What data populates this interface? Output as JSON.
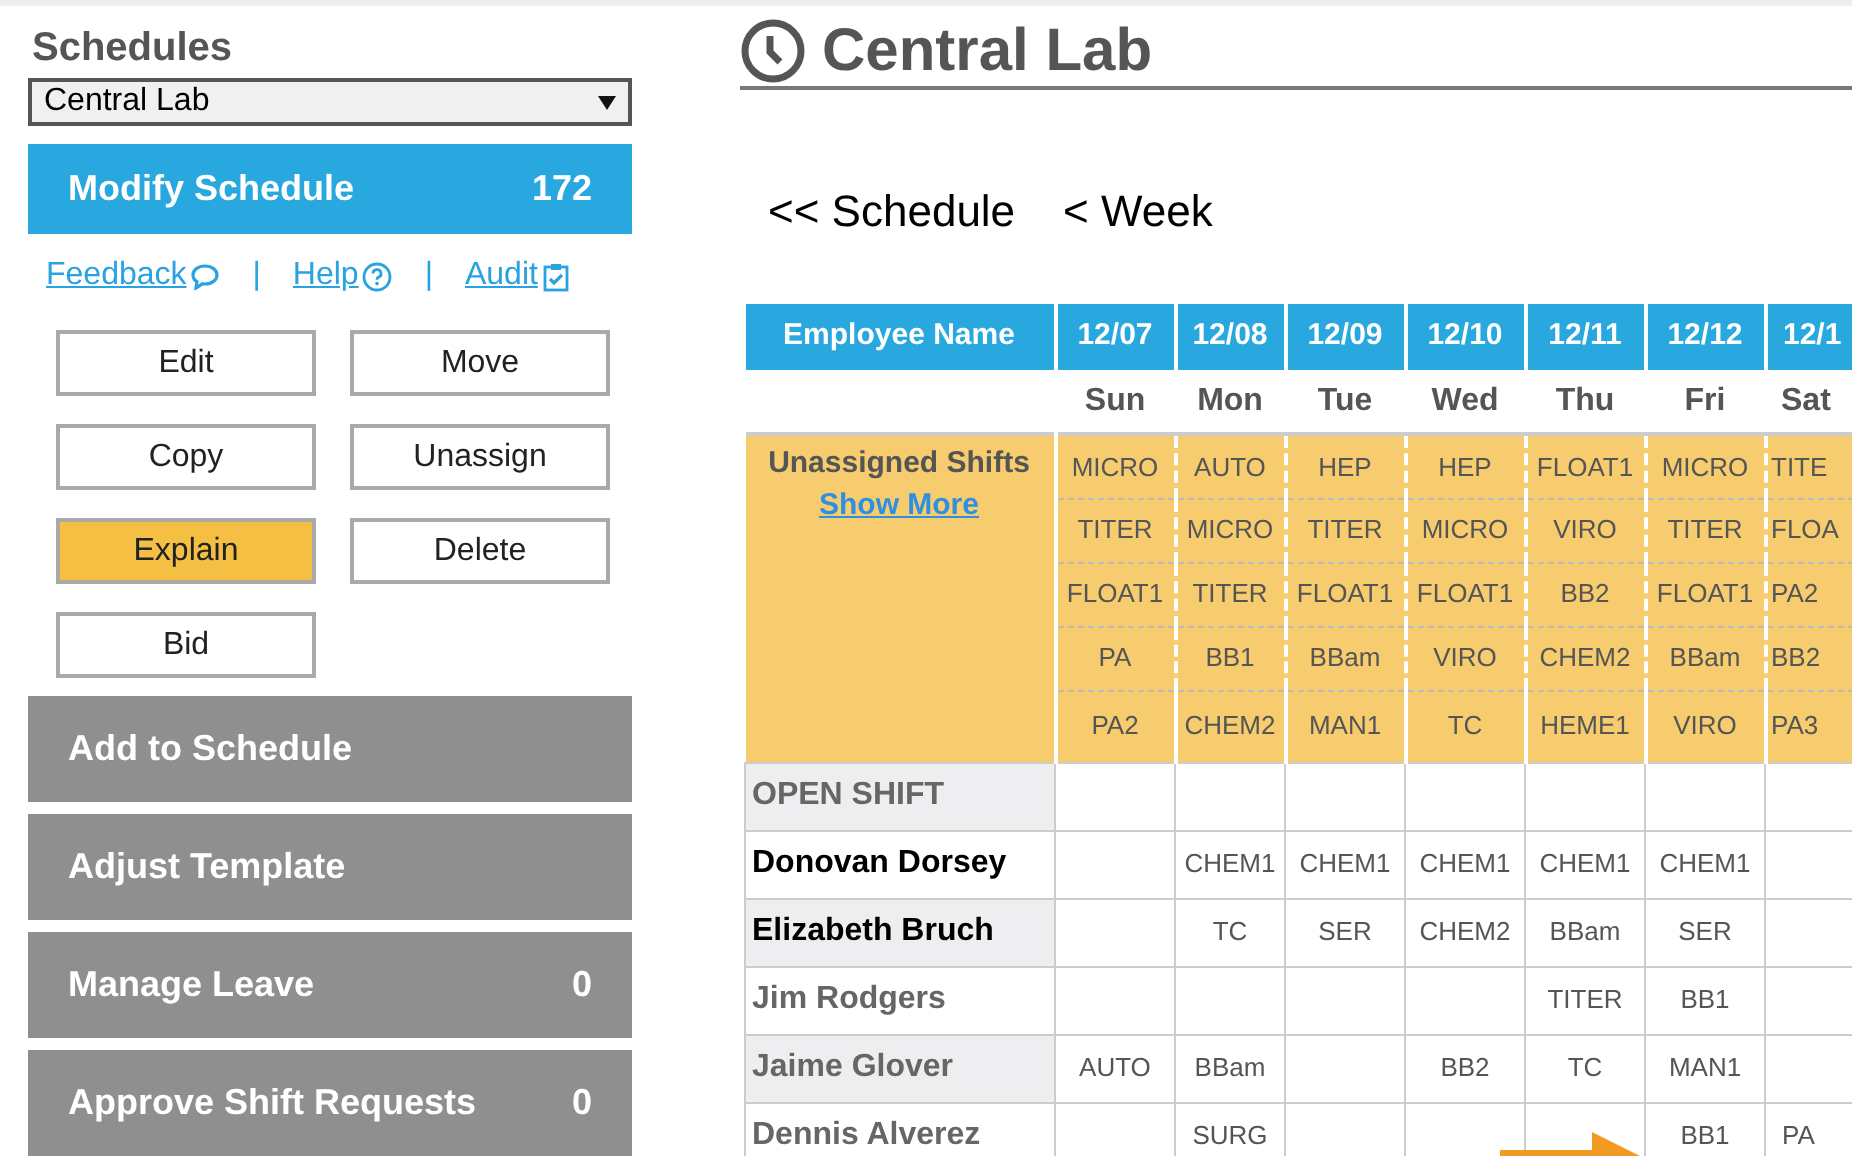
{
  "sidebar": {
    "title": "Schedules",
    "schedule_select": {
      "value": "Central Lab"
    },
    "active_section": {
      "label": "Modify Schedule",
      "count": "172",
      "selected": true
    },
    "links": [
      {
        "kind": "link",
        "label": "Feedback"
      },
      {
        "kind": "separator",
        "label": "|"
      },
      {
        "kind": "link",
        "label": "Help"
      },
      {
        "kind": "separator",
        "label": "|"
      },
      {
        "kind": "link",
        "label": "Audit"
      }
    ],
    "actions": [
      {
        "label": "Edit",
        "selected": false
      },
      {
        "label": "Move",
        "selected": false
      },
      {
        "label": "Copy",
        "selected": false
      },
      {
        "label": "Unassign",
        "selected": false
      },
      {
        "label": "Explain",
        "selected": true
      },
      {
        "label": "Delete",
        "selected": false
      },
      {
        "label": "Bid",
        "selected": false
      }
    ],
    "sections": [
      {
        "label": "Add to Schedule",
        "selected": false
      },
      {
        "label": "Adjust Template",
        "selected": false
      },
      {
        "label": "Manage Leave",
        "count": "0",
        "selected": false
      },
      {
        "label": "Approve Shift Requests",
        "count": "0",
        "selected": false
      }
    ]
  },
  "page_title": "Central Lab",
  "nav": [
    "<< Schedule",
    "< Week"
  ],
  "table": {
    "name_header": "Employee Name",
    "columns": [
      {
        "date": "12/07",
        "day": "Sun"
      },
      {
        "date": "12/08",
        "day": "Mon"
      },
      {
        "date": "12/09",
        "day": "Tue"
      },
      {
        "date": "12/10",
        "day": "Wed"
      },
      {
        "date": "12/11",
        "day": "Thu"
      },
      {
        "date": "12/12",
        "day": "Fri"
      },
      {
        "date": "12/1",
        "day": "Sat"
      }
    ],
    "unassigned": {
      "label": "Unassigned Shifts",
      "link": "Show More",
      "shifts": [
        [
          "MICRO",
          "AUTO",
          "HEP",
          "HEP",
          "FLOAT1",
          "MICRO",
          "TITE"
        ],
        [
          "TITER",
          "MICRO",
          "TITER",
          "MICRO",
          "VIRO",
          "TITER",
          "FLOA"
        ],
        [
          "FLOAT1",
          "TITER",
          "FLOAT1",
          "FLOAT1",
          "BB2",
          "FLOAT1",
          "PA2"
        ],
        [
          "PA",
          "BB1",
          "BBam",
          "VIRO",
          "CHEM2",
          "BBam",
          "BB2"
        ],
        [
          "PA2",
          "CHEM2",
          "MAN1",
          "TC",
          "HEME1",
          "VIRO",
          "PA3"
        ]
      ]
    },
    "rows": [
      {
        "name": "OPEN SHIFT",
        "emphasized": false,
        "cells": [
          null,
          null,
          null,
          null,
          null,
          null,
          null
        ]
      },
      {
        "name": "Donovan Dorsey",
        "emphasized": true,
        "cells": [
          null,
          "CHEM1",
          "CHEM1",
          "CHEM1",
          "CHEM1",
          "CHEM1",
          null
        ]
      },
      {
        "name": "Elizabeth Bruch",
        "emphasized": true,
        "cells": [
          null,
          "TC",
          "SER",
          "CHEM2",
          "BBam",
          "SER",
          null
        ]
      },
      {
        "name": "Jim Rodgers",
        "emphasized": false,
        "cells": [
          null,
          null,
          null,
          null,
          "TITER",
          "BB1",
          null
        ]
      },
      {
        "name": "Jaime Glover",
        "emphasized": false,
        "cells": [
          "AUTO",
          "BBam",
          null,
          "BB2",
          "TC",
          "MAN1",
          null
        ]
      },
      {
        "name": "Dennis Alverez",
        "emphasized": false,
        "cells": [
          null,
          "SURG",
          null,
          null,
          null,
          "BB1",
          "PA"
        ]
      }
    ]
  }
}
